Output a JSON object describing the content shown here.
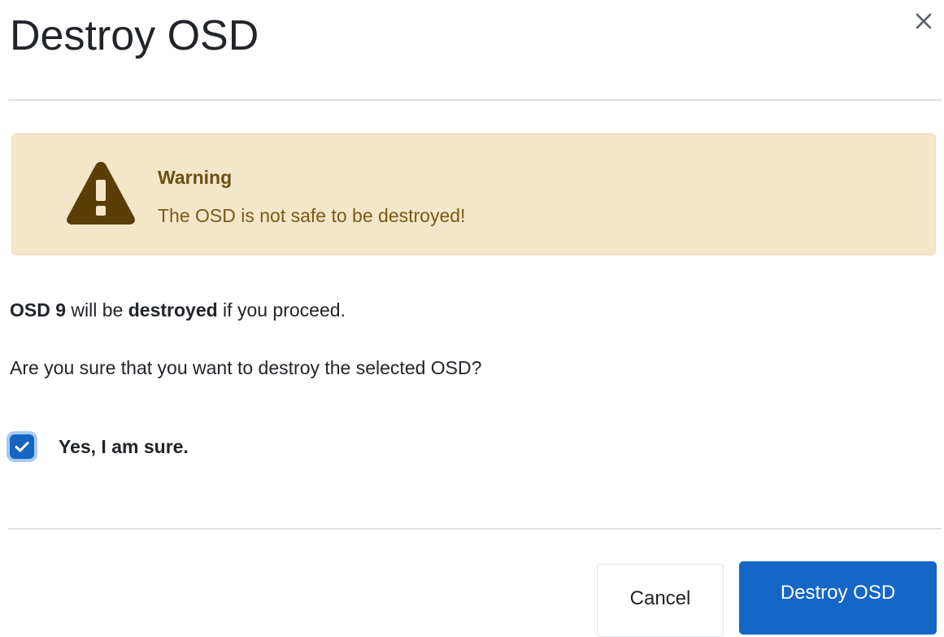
{
  "modal": {
    "title": "Destroy OSD",
    "close_icon": "close-icon"
  },
  "alert": {
    "icon": "warning-triangle-icon",
    "heading": "Warning",
    "text": "The OSD is not safe to be destroyed!",
    "colors": {
      "background": "#f3e6c9",
      "heading": "#6b4f14",
      "icon": "#5b3e06"
    }
  },
  "body": {
    "line1": {
      "osd_name": "OSD 9",
      "part1": " will be ",
      "action": "destroyed",
      "part2": " if you proceed."
    },
    "question": "Are you sure that you want to destroy the selected OSD?"
  },
  "confirmation": {
    "checked": true,
    "label": "Yes, I am sure.",
    "icon": "checkmark-icon"
  },
  "footer": {
    "cancel_label": "Cancel",
    "submit_label": "Destroy OSD",
    "primary_color": "#1466c7"
  }
}
